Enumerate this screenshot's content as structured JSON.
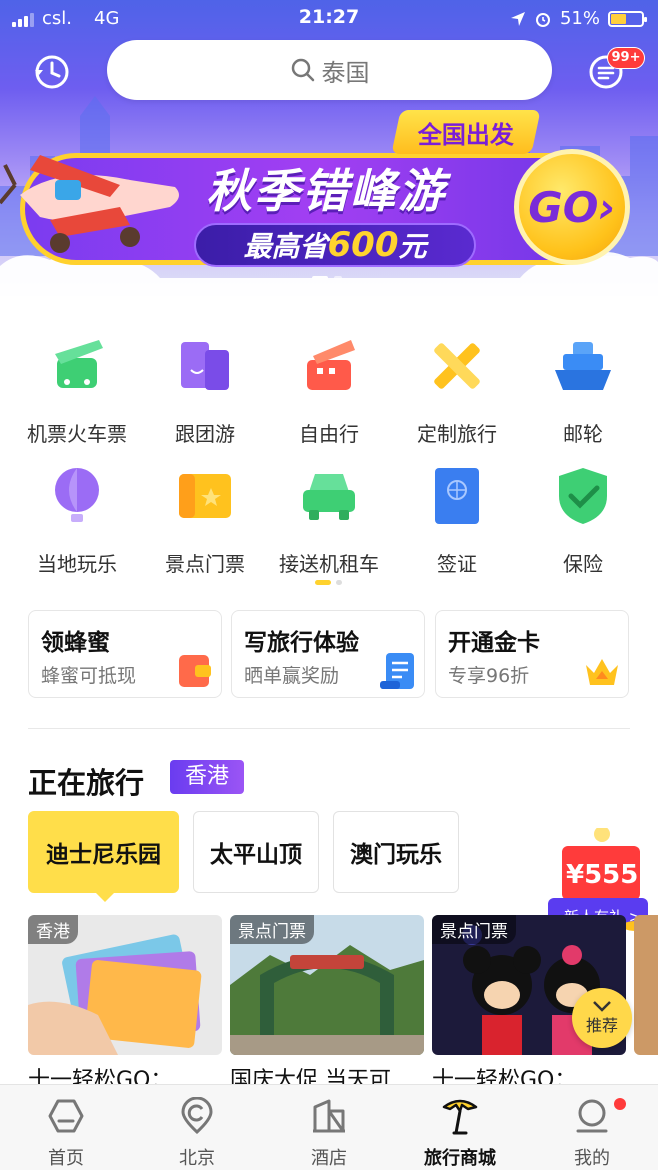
{
  "status_bar": {
    "carrier": "csl.",
    "network": "4G",
    "time": "21:27",
    "battery": "51%"
  },
  "header": {
    "search_placeholder": "泰国",
    "message_badge": "99+"
  },
  "banner": {
    "tag": "全国出发",
    "title": "秋季错峰游",
    "pill_prefix": "最高省",
    "pill_amount": "600",
    "pill_suffix": "元",
    "go_label": "GO›"
  },
  "categories": [
    {
      "label": "机票火车票",
      "icon": "plane-train-icon",
      "color": "#3ecf74"
    },
    {
      "label": "跟团游",
      "icon": "group-flag-icon",
      "color": "#8a5cf5"
    },
    {
      "label": "自由行",
      "icon": "free-travel-icon",
      "color": "#ff5a4a"
    },
    {
      "label": "定制旅行",
      "icon": "custom-tools-icon",
      "color": "#ffc21e"
    },
    {
      "label": "邮轮",
      "icon": "cruise-ship-icon",
      "color": "#3a8cf5"
    },
    {
      "label": "当地玩乐",
      "icon": "balloon-icon",
      "color": "#9b6cf5"
    },
    {
      "label": "景点门票",
      "icon": "ticket-icon",
      "color": "#ffc21e"
    },
    {
      "label": "接送机租车",
      "icon": "car-icon",
      "color": "#3ecf74"
    },
    {
      "label": "签证",
      "icon": "passport-icon",
      "color": "#3a7ef0"
    },
    {
      "label": "保险",
      "icon": "shield-check-icon",
      "color": "#3ecf74"
    }
  ],
  "promo_cards": [
    {
      "title": "领蜂蜜",
      "subtitle": "蜂蜜可抵现",
      "icon": "wallet-icon"
    },
    {
      "title": "写旅行体验",
      "subtitle": "晒单赢奖励",
      "icon": "document-icon"
    },
    {
      "title": "开通金卡",
      "subtitle": "专享96折",
      "icon": "crown-icon"
    }
  ],
  "traveling": {
    "title": "正在旅行",
    "location": "香港",
    "chips": [
      "迪士尼乐园",
      "太平山顶",
      "澳门玩乐"
    ],
    "products": [
      {
        "tag": "香港",
        "title": "十一轻松GO："
      },
      {
        "tag": "景点门票",
        "title": "国庆大促 当天可"
      },
      {
        "tag": "景点门票",
        "title": "十一轻松GO："
      }
    ],
    "new_user_amount": "¥555",
    "new_user_label": "新人有礼 >",
    "recommend_label": "推荐"
  },
  "tabbar": [
    {
      "label": "首页",
      "icon": "home-hexagon-icon"
    },
    {
      "label": "北京",
      "icon": "location-pin-icon"
    },
    {
      "label": "酒店",
      "icon": "hotel-building-icon"
    },
    {
      "label": "旅行商城",
      "icon": "palm-tree-icon",
      "active": true
    },
    {
      "label": "我的",
      "icon": "user-profile-icon"
    }
  ]
}
